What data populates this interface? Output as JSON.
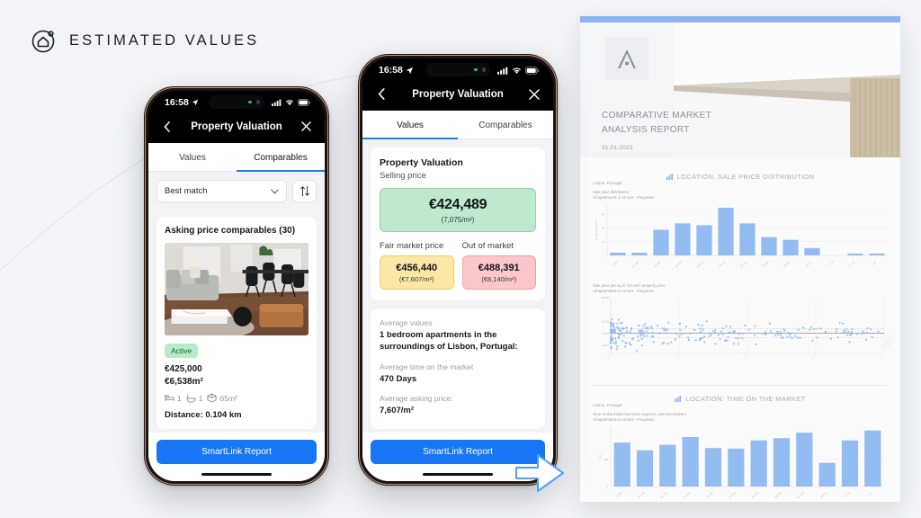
{
  "brand": {
    "text": "ESTIMATED VALUES",
    "icon": "home-circle-icon"
  },
  "phone_left": {
    "status": {
      "time": "16:58",
      "location_icon": "location-arrow-icon",
      "cellular_icon": "cellular-icon",
      "wifi_icon": "wifi-icon",
      "battery_icon": "battery-icon"
    },
    "nav": {
      "back_icon": "chevron-left-icon",
      "title": "Property Valuation",
      "close_icon": "close-icon"
    },
    "tabs": [
      {
        "label": "Values",
        "active": false
      },
      {
        "label": "Comparables",
        "active": true
      }
    ],
    "sort": {
      "value": "Best match",
      "chevron_icon": "chevron-down-icon",
      "order_icon": "sort-updown-icon"
    },
    "card": {
      "title": "Asking price comparables (30)",
      "badge": "Active",
      "price": "€425,000",
      "price_sqm": "€6,538m²",
      "specs": {
        "beds_icon": "bed-icon",
        "beds": "1",
        "baths_icon": "bath-icon",
        "baths": "1",
        "area_icon": "area-icon",
        "area": "65m²"
      },
      "distance": "Distance:  0.104 km"
    },
    "cta": "SmartLink Report"
  },
  "phone_mid": {
    "status": {
      "time": "16:58",
      "location_icon": "location-arrow-icon",
      "cellular_icon": "cellular-icon",
      "wifi_icon": "wifi-icon",
      "battery_icon": "battery-icon"
    },
    "nav": {
      "back_icon": "chevron-left-icon",
      "title": "Property Valuation",
      "close_icon": "close-icon"
    },
    "tabs": [
      {
        "label": "Values",
        "active": true
      },
      {
        "label": "Comparables",
        "active": false
      }
    ],
    "valuation": {
      "title": "Property Valuation",
      "subtitle": "Selling price",
      "selling_amount": "€424,489",
      "selling_per": "(7,075/m²)",
      "fair_label": "Fair market price",
      "out_label": "Out of market",
      "fair_amount": "€456,440",
      "fair_per": "(€7,607/m²)",
      "out_amount": "€488,391",
      "out_per": "(€8,140/m²)"
    },
    "averages": {
      "heading": "Average values",
      "subject": "1 bedroom apartments in the surroundings of Lisbon, Portugal:",
      "time_label": "Average time on the market",
      "time_value": "470 Days",
      "price_label": "Average asking price:",
      "price_value": "7,607/m²"
    },
    "cta": "SmartLink Report"
  },
  "cursor": {
    "icon": "arrow-pointer-right-icon"
  },
  "report": {
    "logo_icon": "a-mark-logo",
    "title": "COMPARATIVE MARKET\nANALYSIS REPORT",
    "title_line1": "COMPARATIVE MARKET",
    "title_line2": "ANALYSIS REPORT",
    "date": "31.01.2023",
    "sections": [
      {
        "icon": "chart-icon",
        "title": "LOCATION. SALE PRICE DISTRIBUTION"
      },
      {
        "icon": "chart-icon",
        "title": "LOCATION: TIME ON THE MARKET"
      }
    ],
    "accent": "#8cb4ef",
    "bar_color": "#93bdf0"
  },
  "chart_data": [
    {
      "type": "bar",
      "title": "LOCATION. SALE PRICE DISTRIBUTION",
      "location": "Lisbon, Portugal",
      "subtitle_line1": "Sale price distribution",
      "subtitle_line2": "All apartments in Arroios - Freguesia",
      "ylabel": "Number of properties",
      "xlabel": "",
      "categories": [
        "0-100k",
        "100-200k",
        "200-300k",
        "300-400k",
        "400-500k",
        "500-600k",
        "600-700k",
        "700-800k",
        "800-900k",
        "900k-1M",
        "1-1.1M",
        "1.1-1.2M",
        "1.2M+"
      ],
      "values": [
        3,
        3,
        28,
        35,
        33,
        52,
        35,
        20,
        17,
        8,
        0,
        2,
        2
      ],
      "ylim": [
        0,
        55
      ],
      "yticks": [
        0,
        15,
        30,
        45
      ],
      "grid": true,
      "legend": "none"
    },
    {
      "type": "scatter",
      "title": "",
      "subtitle_line1": "Sale price per sq.m. for each property price",
      "subtitle_line2": "All apartments in Arroios - Freguesia",
      "ylabel": "Sale price per sq.m.",
      "xlabel": "Property price",
      "ylim": [
        2000,
        16000
      ],
      "yticks_labels": [
        "€16,000",
        "€10,000",
        "€7,000",
        "€4,000"
      ],
      "reference_line": 7075,
      "band_upper": 8140,
      "band_lower": 6000,
      "n_points": 260,
      "grid": true
    },
    {
      "type": "bar",
      "title": "LOCATION: TIME ON THE MARKET",
      "location": "Lisbon, Portugal",
      "subtitle_line1": "Time on the market per price segment, sold and deleted",
      "subtitle_line2": "All apartments in Arroios - Freguesia",
      "ylabel": "Days",
      "xlabel": "",
      "categories": [
        "0-100k",
        "100-200k",
        "200-300k",
        "300-400k",
        "400-500k",
        "500-600k",
        "600-700k",
        "700-800k",
        "800-900k",
        "900k-1M",
        "1-1.1M",
        "1.1M+"
      ],
      "values": [
        400,
        330,
        380,
        450,
        350,
        345,
        420,
        440,
        490,
        215,
        420,
        510
      ],
      "ylim": [
        0,
        540
      ],
      "yticks": [
        0,
        250
      ],
      "grid": true,
      "legend": "none"
    }
  ]
}
